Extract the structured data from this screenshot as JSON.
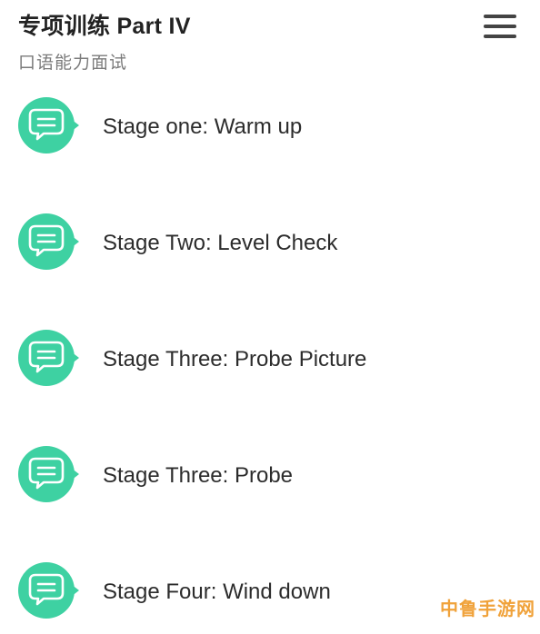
{
  "header": {
    "title": "专项训练  Part IV",
    "subtitle": "口语能力面试",
    "menu_icon": "hamburger-menu-icon"
  },
  "stages": [
    {
      "label": "Stage one: Warm up",
      "icon": "chat-bubble-icon"
    },
    {
      "label": "Stage Two: Level Check",
      "icon": "chat-bubble-icon"
    },
    {
      "label": "Stage Three: Probe Picture",
      "icon": "chat-bubble-icon"
    },
    {
      "label": "Stage Three: Probe",
      "icon": "chat-bubble-icon"
    },
    {
      "label": "Stage Four: Wind down",
      "icon": "chat-bubble-icon"
    }
  ],
  "watermark": "中鲁手游网",
  "colors": {
    "accent": "#3ed1a2",
    "title_text": "#222222",
    "subtitle_text": "#7b7b7b",
    "watermark": "#f0a23a"
  }
}
